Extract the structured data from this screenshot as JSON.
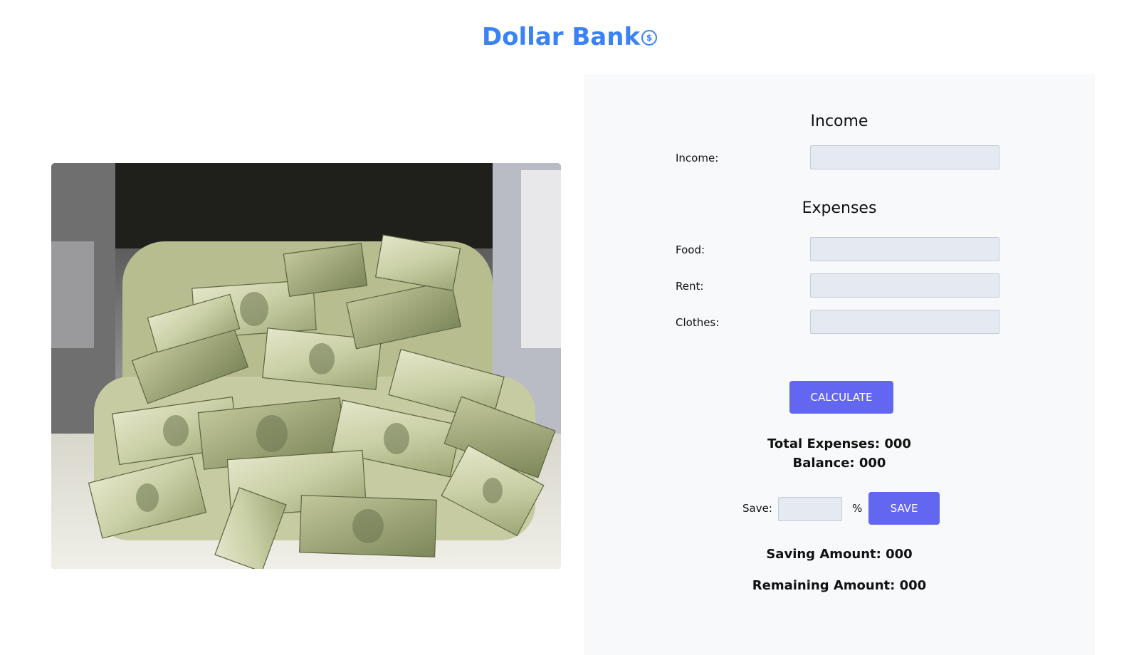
{
  "brand": {
    "title": "Dollar Bank",
    "icon_glyph": "$",
    "icon": "dollar-circle-icon",
    "color": "#3b82f6"
  },
  "hero_image": {
    "subject": "stacks-of-dollar-bills"
  },
  "income_section": {
    "heading": "Income",
    "fields": [
      {
        "label": "Income:",
        "value": "",
        "placeholder": ""
      }
    ]
  },
  "expenses_section": {
    "heading": "Expenses",
    "fields": [
      {
        "label": "Food:",
        "value": "",
        "placeholder": ""
      },
      {
        "label": "Rent:",
        "value": "",
        "placeholder": ""
      },
      {
        "label": "Clothes:",
        "value": "",
        "placeholder": ""
      }
    ]
  },
  "calculate_button": {
    "label": "Calculate"
  },
  "results": {
    "total_expenses": "Total Expenses: 000",
    "balance": "Balance: 000"
  },
  "save": {
    "label": "Save:",
    "value": "",
    "unit": "%",
    "button_label": "Save"
  },
  "savings_results": {
    "saving_amount": "Saving Amount: 000",
    "remaining_amount": "Remaining Amount: 000"
  },
  "colors": {
    "accent_button": "#6366f1",
    "panel_background": "#f7f9fb",
    "input_background": "#e5e9f2"
  }
}
